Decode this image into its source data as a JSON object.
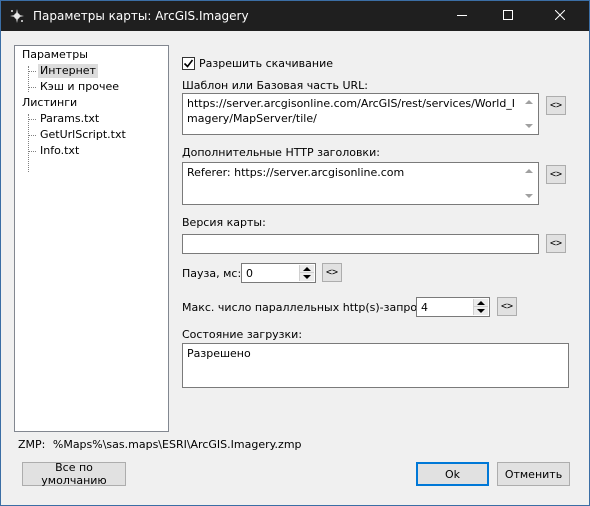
{
  "window": {
    "title": "Параметры карты: ArcGIS.Imagery"
  },
  "tree": {
    "items": [
      {
        "label": "Параметры"
      },
      {
        "label": "Интернет",
        "selected": true
      },
      {
        "label": "Кэш и прочее"
      },
      {
        "label": "Листинги"
      },
      {
        "label": "Params.txt"
      },
      {
        "label": "GetUrlScript.txt"
      },
      {
        "label": "Info.txt"
      }
    ]
  },
  "form": {
    "allow_download_label": "Разрешить скачивание",
    "allow_download_checked": true,
    "url_label": "Шаблон или Базовая часть URL:",
    "url_value": "https://server.arcgisonline.com/ArcGIS/rest/services/World_Imagery/MapServer/tile/",
    "headers_label": "Дополнительные HTTP заголовки:",
    "headers_value": "Referer: https://server.arcgisonline.com",
    "version_label": "Версия карты:",
    "version_value": "",
    "pause_label": "Пауза, мс:",
    "pause_value": "0",
    "max_requests_label": "Макс. число параллельных http(s)-запросов:",
    "max_requests_value": "4",
    "status_label": "Состояние загрузки:",
    "status_value": "Разрешено",
    "reset_arrow": "<>"
  },
  "zmp": {
    "label": "ZMP:",
    "path": "%Maps%\\sas.maps\\ESRI\\ArcGIS.Imagery.zmp"
  },
  "buttons": {
    "defaults": "Все по умолчанию",
    "ok": "Ok",
    "cancel": "Отменить"
  },
  "colors": {
    "titlebar": "#1f1f1f",
    "accent": "#0078d7",
    "window_bg": "#f0f0f0"
  },
  "icons": {
    "title": "sas-planet-icon",
    "minimize": "minimize-icon",
    "maximize": "maximize-icon",
    "close": "close-icon"
  }
}
